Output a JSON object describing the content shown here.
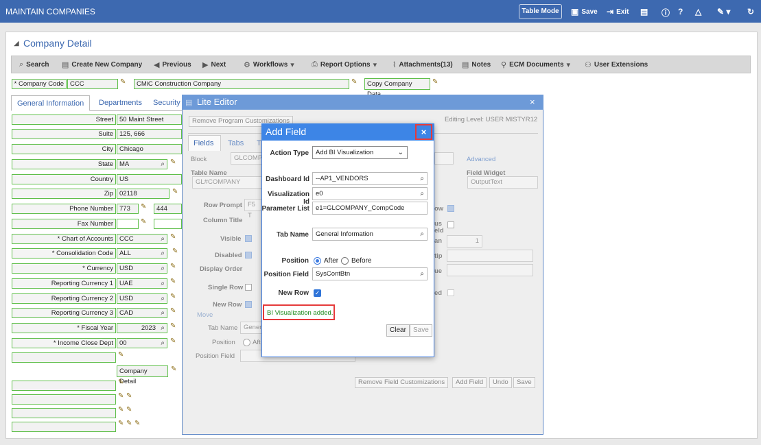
{
  "topbar": {
    "title": "MAINTAIN COMPANIES",
    "table_mode": "Table Mode",
    "save": "Save",
    "exit": "Exit"
  },
  "section_title": "Company Detail",
  "toolbar": {
    "search": "Search",
    "create": "Create New Company",
    "previous": "Previous",
    "next": "Next",
    "workflows": "Workflows",
    "report_options": "Report Options",
    "attachments": "Attachments(13)",
    "notes": "Notes",
    "ecm": "ECM Documents",
    "user_ext": "User Extensions"
  },
  "company": {
    "code_label": "* Company Code",
    "code": "CCC",
    "name": "CMiC Construction Company",
    "copy_button": "Copy Company Data"
  },
  "tabs": [
    "General Information",
    "Departments",
    "Security"
  ],
  "form": {
    "street_label": "Street",
    "street": "50 Maint Street",
    "suite_label": "Suite",
    "suite": "125, 666",
    "city_label": "City",
    "city": "Chicago",
    "state_label": "State",
    "state": "MA",
    "country_label": "Country",
    "country": "US",
    "zip_label": "Zip",
    "zip": "02118",
    "phone_label": "Phone Number",
    "phone_area": "773",
    "phone_num": "444",
    "fax_label": "Fax Number",
    "coa_label": "* Chart of Accounts",
    "coa": "CCC",
    "cons_label": "* Consolidation Code",
    "cons": "ALL",
    "currency_label": "* Currency",
    "currency": "USD",
    "rc1_label": "Reporting Currency 1",
    "rc1": "UAE",
    "rc2_label": "Reporting Currency 2",
    "rc2": "USD",
    "rc3_label": "Reporting Currency 3",
    "rc3": "CAD",
    "fy_label": "* Fiscal Year",
    "fy": "2023",
    "icd_label": "* Income Close Dept",
    "icd": "00",
    "company_detail_btn": "Company Detail"
  },
  "lite_editor": {
    "title": "Lite Editor",
    "remove_prog": "Remove Program Customizations",
    "editing_level": "Editing Level: USER MISTYR12",
    "tab_fields": "Fields",
    "tab_tabs": "Tabs",
    "tab_t": "T",
    "block_label": "Block",
    "block_value": "GLCOMP",
    "table_name_label": "Table Name",
    "table_name_value": "GL#COMPANY",
    "advanced": "Advanced",
    "field_widget_label": "Field Widget",
    "field_widget_value": "OutputText",
    "row_prompt": "Row Prompt",
    "row_prompt_value": "F5 T",
    "column_title": "Column Title",
    "visible": "Visible",
    "disabled": "Disabled",
    "display_order": "Display Order",
    "single_row": "Single Row",
    "new_row": "New Row",
    "move": "Move",
    "tab_name": "Tab Name",
    "tab_name_value": "Gener",
    "position": "Position",
    "position_after": "Aft",
    "position_field": "Position Field",
    "right_ow": "ow",
    "right_us": "us",
    "right_eld": "eld",
    "right_an": "an",
    "right_an_value": "1",
    "right_tip": "tip",
    "right_ue": "ue",
    "right_ed": "ed",
    "remove_field": "Remove Field Customizations",
    "add_field": "Add Field",
    "undo": "Undo",
    "save": "Save"
  },
  "add_field": {
    "title": "Add Field",
    "close": "×",
    "action_type_label": "Action Type",
    "action_type": "Add BI Visualization",
    "dashboard_label": "Dashboard Id",
    "dashboard": "--AP1_VENDORS",
    "visualization_label": "Visualization Id",
    "visualization": "e0",
    "param_label": "Parameter List",
    "param": "e1=GLCOMPANY_CompCode",
    "tab_name_label": "Tab Name",
    "tab_name": "General Information",
    "position_label": "Position",
    "after": "After",
    "before": "Before",
    "position_field_label": "Position Field",
    "position_field": "SysContBtn",
    "new_row_label": "New Row",
    "message": "BI Visualization added.",
    "clear": "Clear",
    "save": "Save"
  }
}
